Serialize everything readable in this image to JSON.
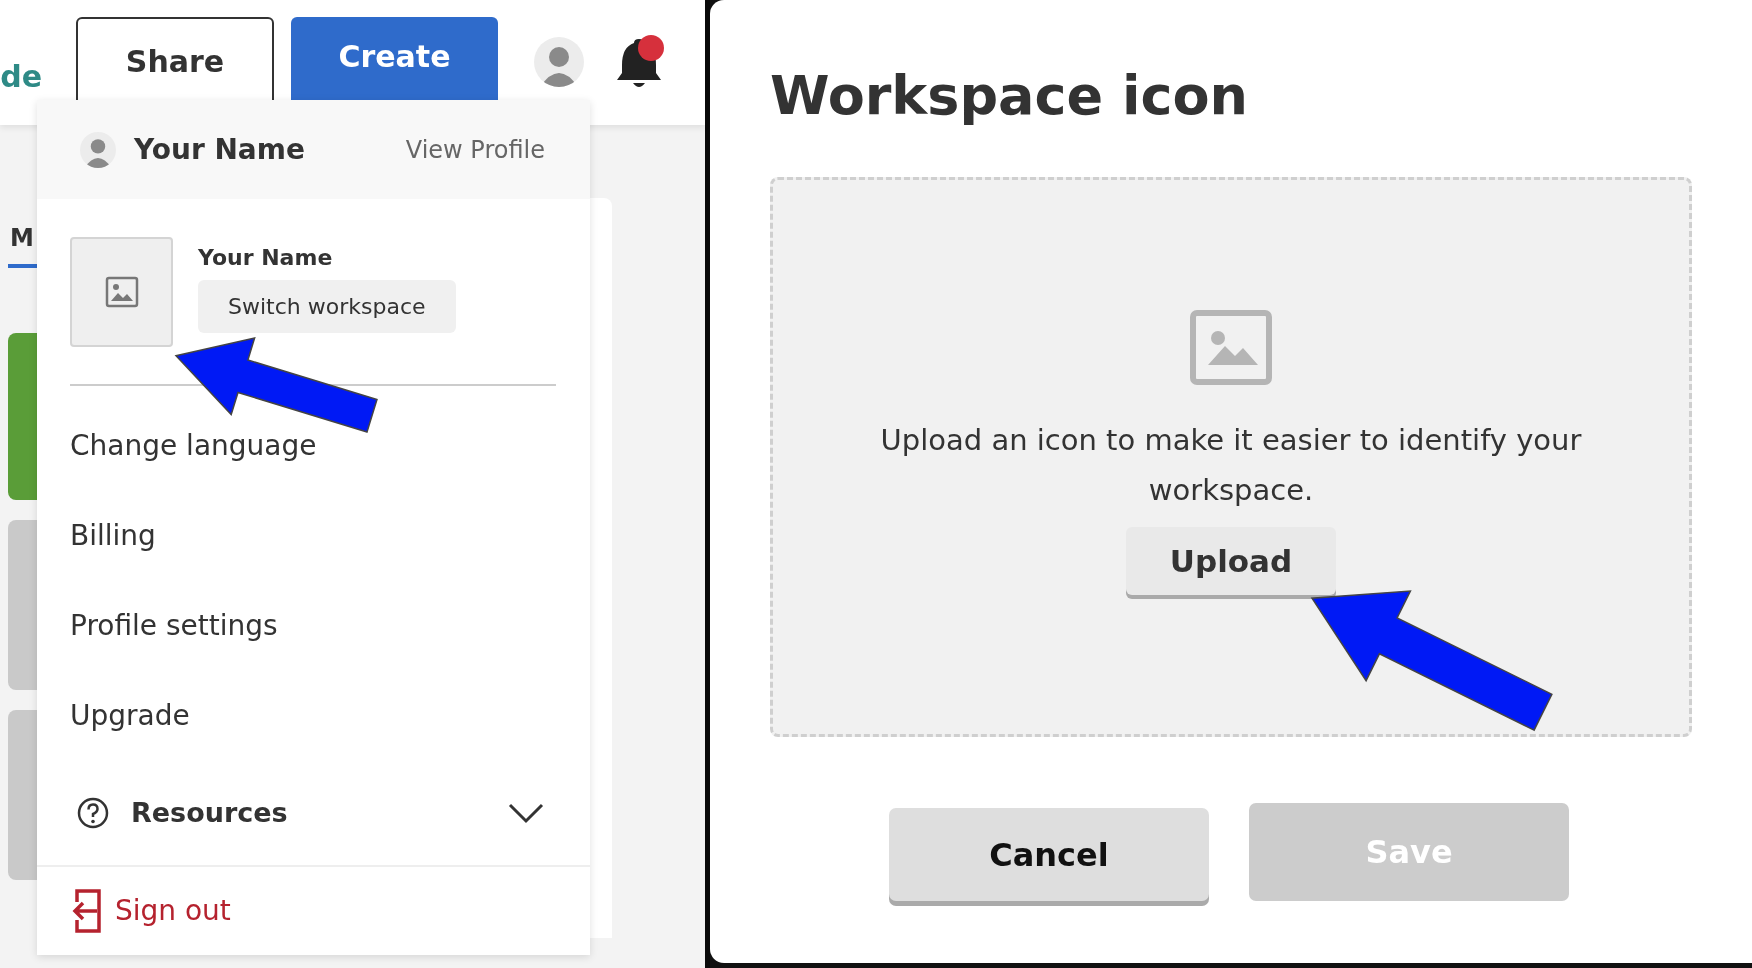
{
  "background_app": {
    "logo_fragment": "de",
    "tabs": [
      {
        "label": "M",
        "selected": true
      }
    ]
  },
  "toolbar": {
    "share_button": "Share",
    "create_button": "Create",
    "notifications": {
      "unread": true
    }
  },
  "profile_menu": {
    "header": {
      "name": "Your Name",
      "view_profile": "View Profile"
    },
    "workspace": {
      "name": "Your Name",
      "switch_button": "Switch workspace"
    },
    "items": [
      {
        "kind": "link",
        "label": "Change language"
      },
      {
        "kind": "link",
        "label": "Billing"
      },
      {
        "kind": "link",
        "label": "Profile settings"
      },
      {
        "kind": "link",
        "label": "Upgrade"
      },
      {
        "kind": "expandable",
        "label": "Resources",
        "expanded": false
      }
    ],
    "sign_out": "Sign out"
  },
  "dialog": {
    "title": "Workspace icon",
    "dropzone": {
      "message": "Upload an icon to make it easier to identify your workspace.",
      "upload_button": "Upload"
    },
    "buttons": [
      {
        "kind": "secondary",
        "label": "Cancel",
        "disabled": false
      },
      {
        "kind": "primary",
        "label": "Save",
        "disabled": true
      }
    ]
  }
}
